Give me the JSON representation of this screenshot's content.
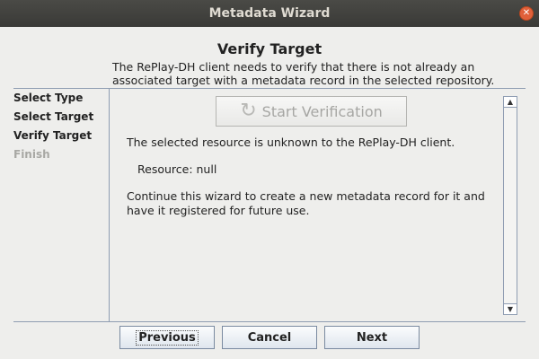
{
  "window": {
    "title": "Metadata Wizard",
    "close_glyph": "✕"
  },
  "header": {
    "title": "Verify Target",
    "description": "The RePlay-DH client needs to verify that there is not already an associated target with a metadata record in the selected repository."
  },
  "steps": [
    {
      "label": "Select Type"
    },
    {
      "label": "Select Target"
    },
    {
      "label": "Verify Target"
    },
    {
      "label": "Finish"
    }
  ],
  "content": {
    "verify_button_label": "Start Verification",
    "verify_icon_glyph": "↻",
    "message_unknown": "The selected resource is unknown to the RePlay-DH client.",
    "resource_line": "Resource: null",
    "continue_message": " Continue this wizard to create a new metadata record for it and have it registered for future use."
  },
  "scrollbar": {
    "up_glyph": "▲",
    "down_glyph": "▼"
  },
  "buttons": {
    "previous": "Previous",
    "cancel": "Cancel",
    "next": "Next"
  }
}
